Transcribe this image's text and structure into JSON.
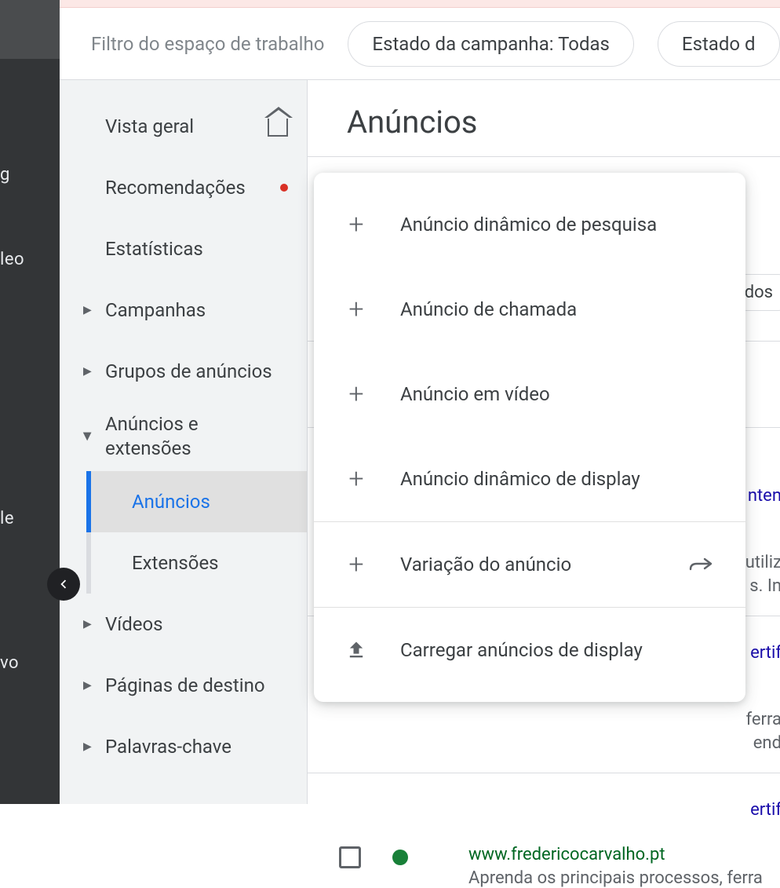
{
  "dark_rail": {
    "item_g": "g",
    "item_leo": "leo",
    "item_le": "le",
    "item_vo": "vo"
  },
  "filter_bar": {
    "label": "Filtro do espaço de trabalho",
    "chip1": "Estado da campanha: Todas",
    "chip2": "Estado d"
  },
  "side_nav": {
    "overview": "Vista geral",
    "recommendations": "Recomendações",
    "stats": "Estatísticas",
    "campaigns": "Campanhas",
    "ad_groups": "Grupos de anúncios",
    "ads_ext": "Anúncios e extensões",
    "ads": "Anúncios",
    "extensions": "Extensões",
    "videos": "Vídeos",
    "landing_pages": "Páginas de destino",
    "keywords": "Palavras-chave"
  },
  "main": {
    "title": "Anúncios"
  },
  "menu": {
    "items": [
      "Anúncio dinâmico de pesquisa",
      "Anúncio de chamada",
      "Anúncio em vídeo",
      "Anúncio dinâmico de display",
      "Variação do anúncio",
      "Carregar anúncios de display"
    ]
  },
  "bg": {
    "chip": "dos",
    "t1": "nten",
    "t2": "utiliz",
    "t3": "s. In",
    "t4": "ertif",
    "t5": "ferra",
    "t6": "end",
    "t7": "ertif",
    "url": "www.fredericocarvalho.pt",
    "desc": "Aprenda os principais processos, ferra"
  }
}
